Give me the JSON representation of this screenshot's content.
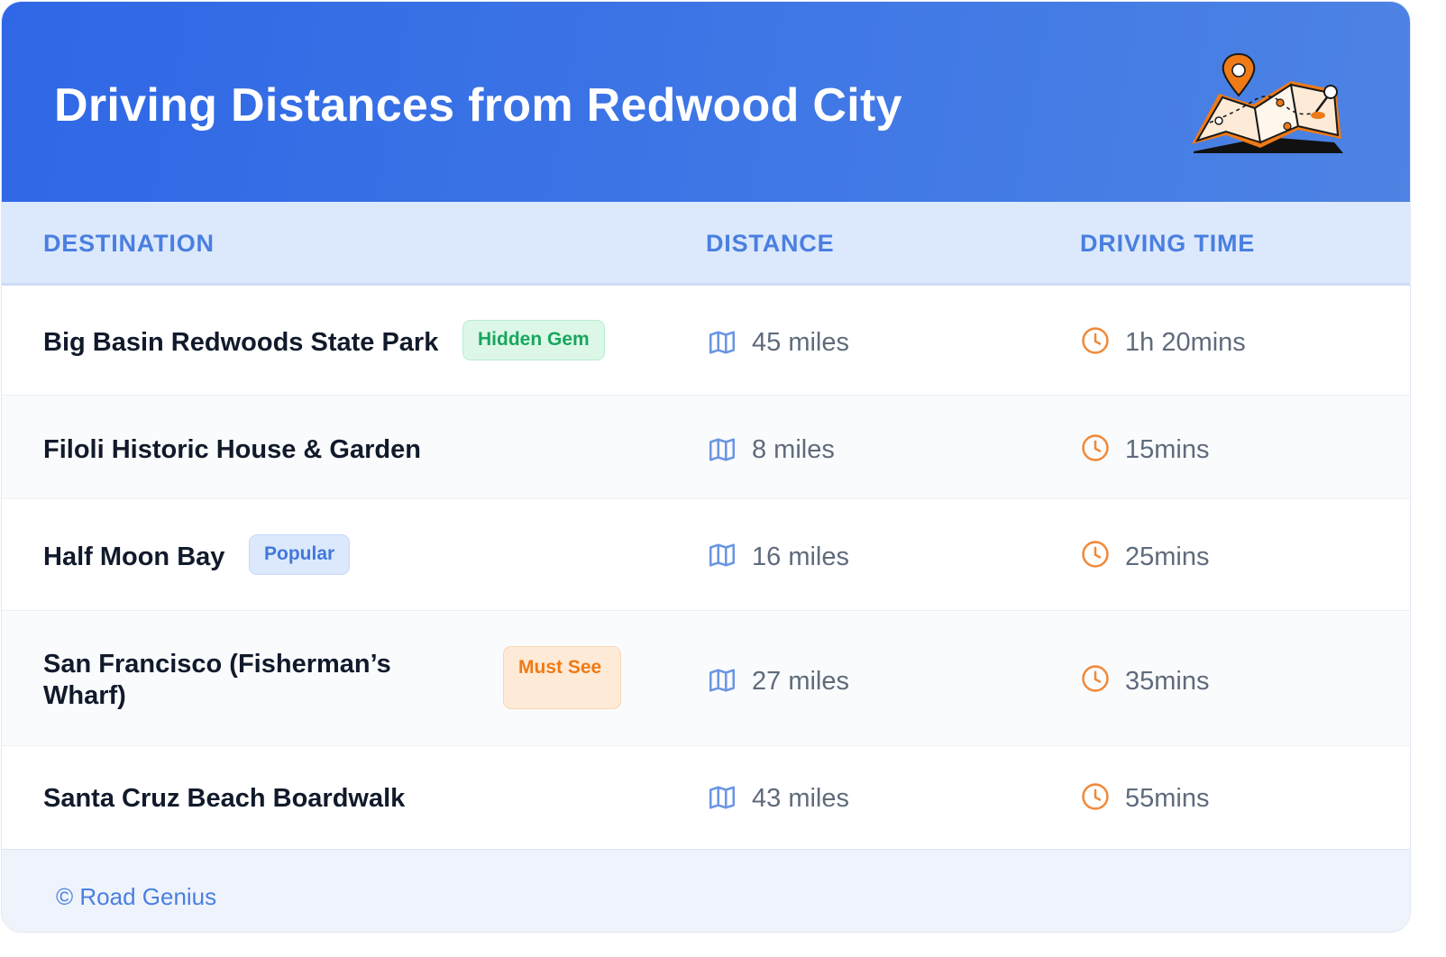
{
  "header": {
    "title": "Driving Distances from Redwood City",
    "illustration_icon": "folded-map-with-location-pin-icon"
  },
  "table": {
    "columns": [
      "DESTINATION",
      "DISTANCE",
      "DRIVING TIME"
    ],
    "rows": [
      {
        "destination": "Big Basin Redwoods State Park",
        "badge": "Hidden Gem",
        "badge_style": "green",
        "distance": "45 miles",
        "time": "1h 20mins"
      },
      {
        "destination": "Filoli Historic House & Garden",
        "badge": "",
        "badge_style": "",
        "distance": "8 miles",
        "time": "15mins"
      },
      {
        "destination": "Half Moon Bay",
        "badge": "Popular",
        "badge_style": "blue",
        "distance": "16 miles",
        "time": "25mins"
      },
      {
        "destination": "San Francisco (Fisherman’s Wharf)",
        "badge": "Must See",
        "badge_style": "orange",
        "distance": "27 miles",
        "time": "35mins"
      },
      {
        "destination": "Santa Cruz Beach Boardwalk",
        "badge": "",
        "badge_style": "",
        "distance": "43 miles",
        "time": "55mins"
      }
    ],
    "distance_icon": "map-icon",
    "time_icon": "clock-icon"
  },
  "footer": {
    "credit": "© Road Genius"
  },
  "colors": {
    "header_gradient_start": "#2f67e6",
    "header_gradient_end": "#4d83e3",
    "column_header_bg": "#dce9fc",
    "column_header_text": "#4a7fe0",
    "distance_icon": "#6a96e4",
    "time_icon": "#f08a3c",
    "badge_green": "#17a75d",
    "badge_blue": "#4178db",
    "badge_orange": "#ef7a16"
  }
}
